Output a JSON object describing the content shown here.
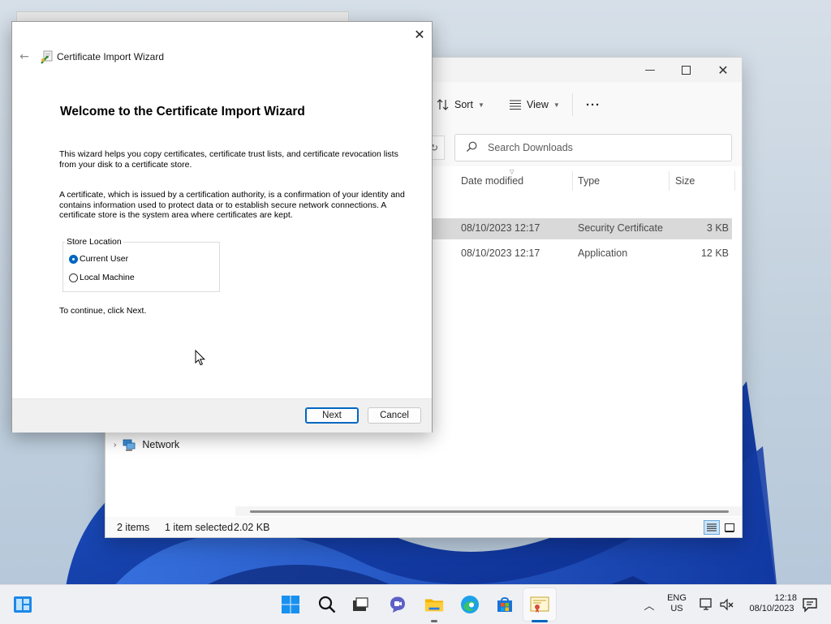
{
  "explorer": {
    "commands": {
      "sort": "Sort",
      "view": "View",
      "more": "···"
    },
    "search_placeholder": "Search Downloads",
    "columns": {
      "date_modified": "Date modified",
      "type": "Type",
      "size": "Size"
    },
    "rows": [
      {
        "date": "08/10/2023 12:17",
        "type": "Security Certificate",
        "size": "3 KB",
        "selected": true
      },
      {
        "date": "08/10/2023 12:17",
        "type": "Application",
        "size": "12 KB",
        "selected": false
      }
    ],
    "nav_network": "Network",
    "status": {
      "items": "2 items",
      "selected": "1 item selected",
      "size": "2.02 KB"
    }
  },
  "wizard": {
    "title": "Certificate Import Wizard",
    "heading": "Welcome to the Certificate Import Wizard",
    "para1": "This wizard helps you copy certificates, certificate trust lists, and certificate revocation lists from your disk to a certificate store.",
    "para2": "A certificate, which is issued by a certification authority, is a confirmation of your identity and contains information used to protect data or to establish secure network connections. A certificate store is the system area where certificates are kept.",
    "store_location_label": "Store Location",
    "options": [
      {
        "label": "Current User",
        "checked": true
      },
      {
        "label": "Local Machine",
        "checked": false
      }
    ],
    "continue_text": "To continue, click Next.",
    "next_label": "Next",
    "cancel_label": "Cancel"
  },
  "taskbar": {
    "lang_top": "ENG",
    "lang_bottom": "US",
    "time": "12:18",
    "date": "08/10/2023"
  },
  "colors": {
    "accent": "#0067c0",
    "selection_row": "#d9d9d9",
    "taskbar_bg": "#eef0f4"
  }
}
